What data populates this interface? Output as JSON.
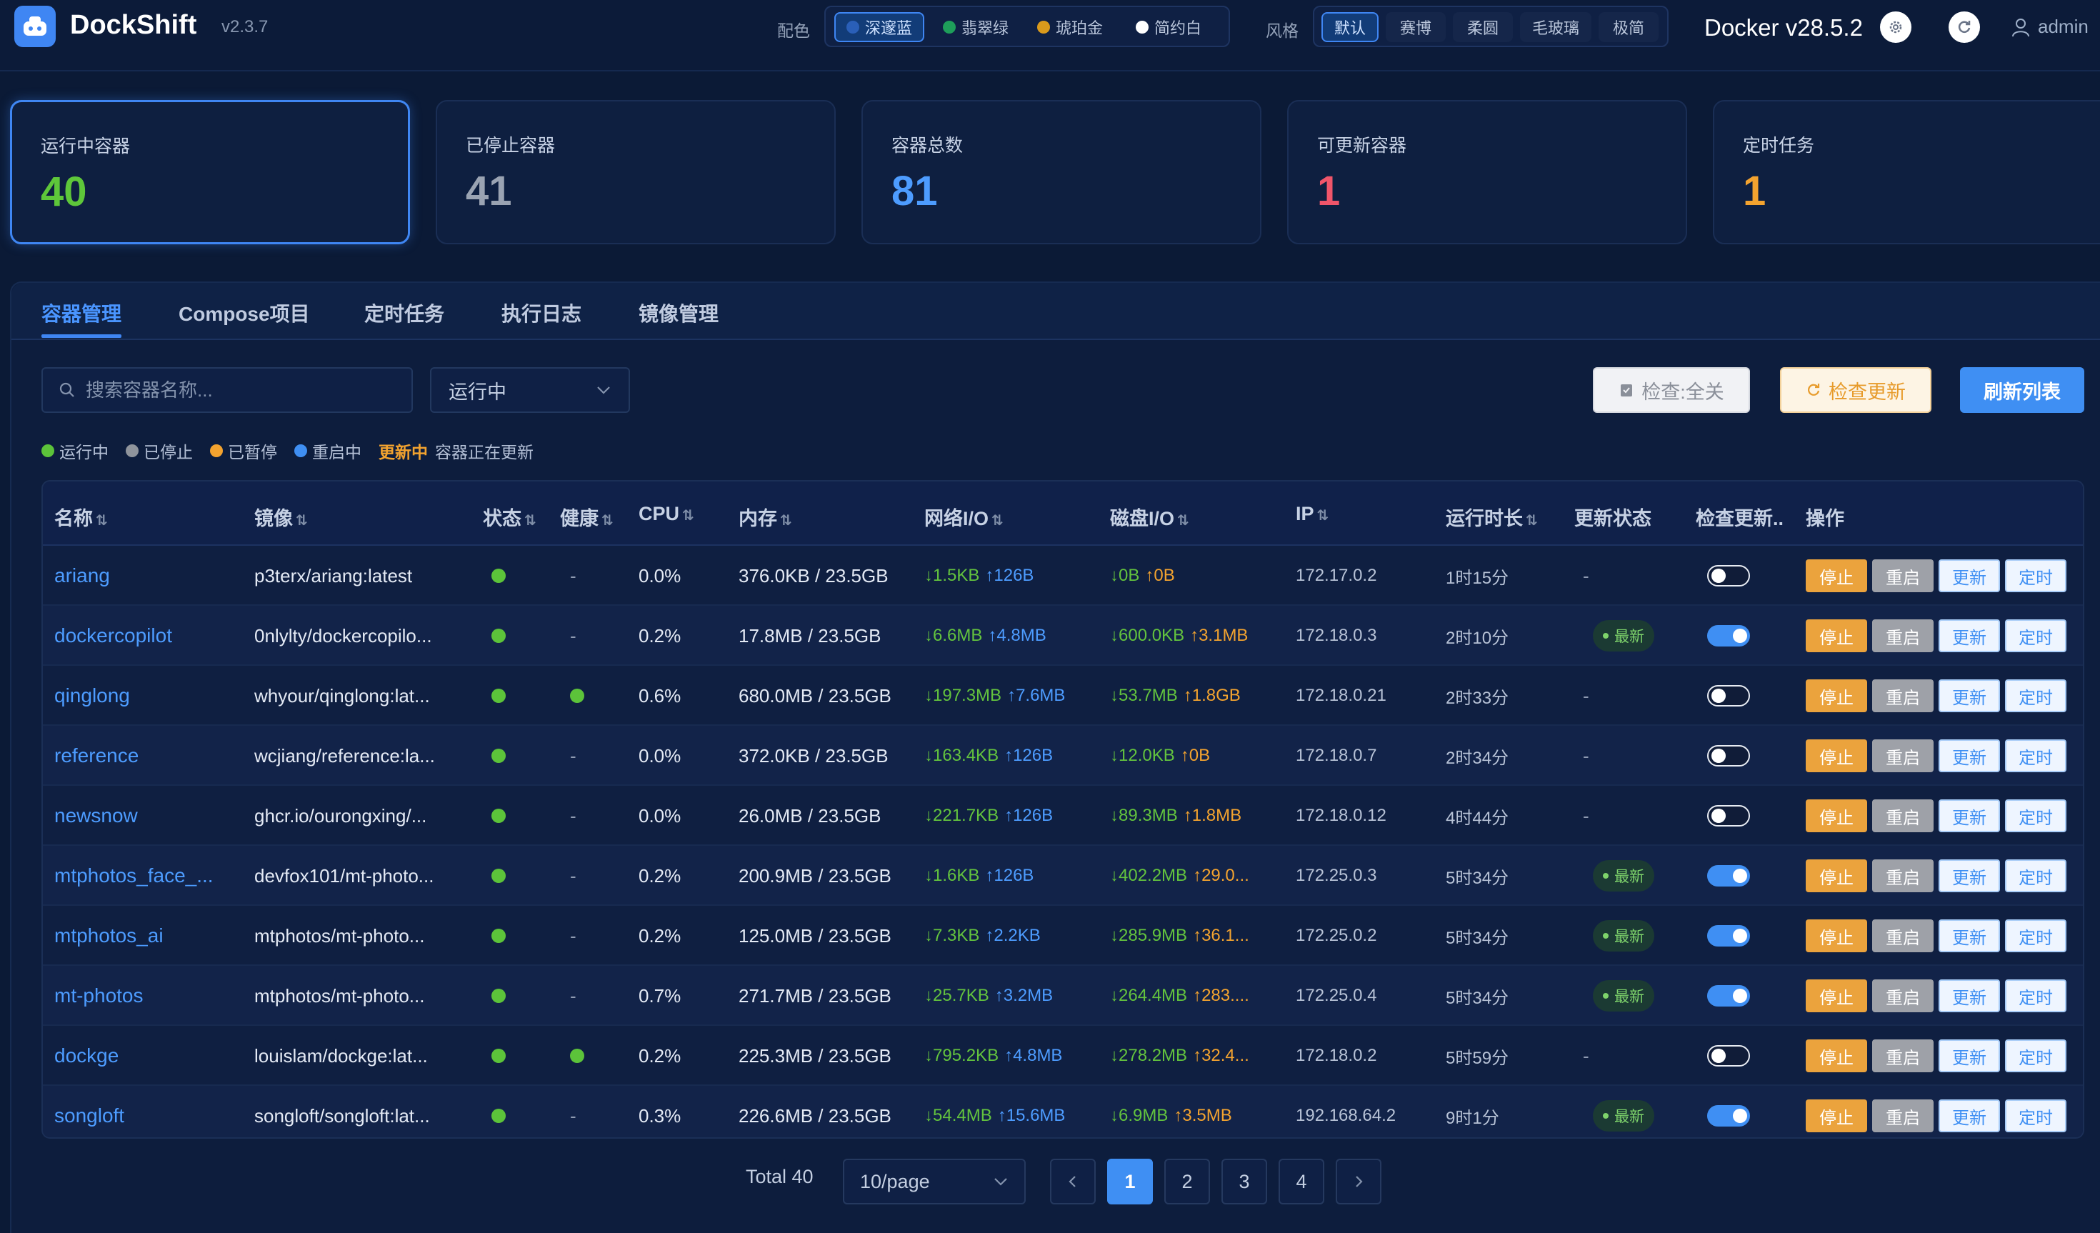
{
  "header": {
    "brand": "DockShift",
    "version": "v2.3.7",
    "color_label": "配色",
    "color_options": [
      {
        "label": "深邃蓝",
        "color": "#2a5fb8"
      },
      {
        "label": "翡翠绿",
        "color": "#1e9e5a"
      },
      {
        "label": "琥珀金",
        "color": "#d99a1c"
      },
      {
        "label": "简约白",
        "color": "#ffffff"
      }
    ],
    "style_label": "风格",
    "style_options": [
      "默认",
      "赛博",
      "柔圆",
      "毛玻璃",
      "极简"
    ],
    "docker_version": "Docker v28.5.2",
    "user": "admin"
  },
  "stats": [
    {
      "label": "运行中容器",
      "value": "40",
      "color": "#5ec73a"
    },
    {
      "label": "已停止容器",
      "value": "41",
      "color": "#9aa3b2"
    },
    {
      "label": "容器总数",
      "value": "81",
      "color": "#4d9cff"
    },
    {
      "label": "可更新容器",
      "value": "1",
      "color": "#f0556a"
    },
    {
      "label": "定时任务",
      "value": "1",
      "color": "#f3a32f"
    }
  ],
  "tabs": [
    "容器管理",
    "Compose项目",
    "定时任务",
    "执行日志",
    "镜像管理"
  ],
  "toolbar": {
    "search_placeholder": "搜索容器名称...",
    "status_filter": "运行中",
    "check_toggle_label": "检查:全关",
    "check_update_label": "检查更新",
    "refresh_label": "刷新列表"
  },
  "legend": {
    "running": "运行中",
    "stopped": "已停止",
    "paused": "已暂停",
    "restarting": "重启中",
    "updating_tag": "更新中",
    "updating_desc": "容器正在更新"
  },
  "table": {
    "headers": [
      "名称",
      "镜像",
      "状态",
      "健康",
      "CPU",
      "内存",
      "网络I/O",
      "磁盘I/O",
      "IP",
      "运行时长",
      "更新状态",
      "检查更新..",
      "操作"
    ],
    "action_labels": {
      "stop": "停止",
      "restart": "重启",
      "update": "更新",
      "timer": "定时"
    },
    "latest_label": "最新",
    "rows": [
      {
        "name": "ariang",
        "image": "p3terx/ariang:latest",
        "health": "-",
        "cpu": "0.0%",
        "mem": "376.0KB / 23.5GB",
        "net_down": "↓1.5KB",
        "net_up": "↑126B",
        "disk_down": "↓0B",
        "disk_up": "↑0B",
        "ip": "172.17.0.2",
        "uptime": "1时15分",
        "update_status": "-",
        "check": false
      },
      {
        "name": "dockercopilot",
        "image": "0nlylty/dockercopilo...",
        "health": "-",
        "cpu": "0.2%",
        "mem": "17.8MB / 23.5GB",
        "net_down": "↓6.6MB",
        "net_up": "↑4.8MB",
        "disk_down": "↓600.0KB",
        "disk_up": "↑3.1MB",
        "ip": "172.18.0.3",
        "uptime": "2时10分",
        "update_status": "latest",
        "check": true
      },
      {
        "name": "qinglong",
        "image": "whyour/qinglong:lat...",
        "health": "dot",
        "cpu": "0.6%",
        "mem": "680.0MB / 23.5GB",
        "net_down": "↓197.3MB",
        "net_up": "↑7.6MB",
        "disk_down": "↓53.7MB",
        "disk_up": "↑1.8GB",
        "ip": "172.18.0.21",
        "uptime": "2时33分",
        "update_status": "-",
        "check": false
      },
      {
        "name": "reference",
        "image": "wcjiang/reference:la...",
        "health": "-",
        "cpu": "0.0%",
        "mem": "372.0KB / 23.5GB",
        "net_down": "↓163.4KB",
        "net_up": "↑126B",
        "disk_down": "↓12.0KB",
        "disk_up": "↑0B",
        "ip": "172.18.0.7",
        "uptime": "2时34分",
        "update_status": "-",
        "check": false
      },
      {
        "name": "newsnow",
        "image": "ghcr.io/ourongxing/...",
        "health": "-",
        "cpu": "0.0%",
        "mem": "26.0MB / 23.5GB",
        "net_down": "↓221.7KB",
        "net_up": "↑126B",
        "disk_down": "↓89.3MB",
        "disk_up": "↑1.8MB",
        "ip": "172.18.0.12",
        "uptime": "4时44分",
        "update_status": "-",
        "check": false
      },
      {
        "name": "mtphotos_face_...",
        "image": "devfox101/mt-photo...",
        "health": "-",
        "cpu": "0.2%",
        "mem": "200.9MB / 23.5GB",
        "net_down": "↓1.6KB",
        "net_up": "↑126B",
        "disk_down": "↓402.2MB",
        "disk_up": "↑29.0...",
        "ip": "172.25.0.3",
        "uptime": "5时34分",
        "update_status": "latest",
        "check": true
      },
      {
        "name": "mtphotos_ai",
        "image": "mtphotos/mt-photo...",
        "health": "-",
        "cpu": "0.2%",
        "mem": "125.0MB / 23.5GB",
        "net_down": "↓7.3KB",
        "net_up": "↑2.2KB",
        "disk_down": "↓285.9MB",
        "disk_up": "↑36.1...",
        "ip": "172.25.0.2",
        "uptime": "5时34分",
        "update_status": "latest",
        "check": true
      },
      {
        "name": "mt-photos",
        "image": "mtphotos/mt-photo...",
        "health": "-",
        "cpu": "0.7%",
        "mem": "271.7MB / 23.5GB",
        "net_down": "↓25.7KB",
        "net_up": "↑3.2MB",
        "disk_down": "↓264.4MB",
        "disk_up": "↑283....",
        "ip": "172.25.0.4",
        "uptime": "5时34分",
        "update_status": "latest",
        "check": true
      },
      {
        "name": "dockge",
        "image": "louislam/dockge:lat...",
        "health": "dot",
        "cpu": "0.2%",
        "mem": "225.3MB / 23.5GB",
        "net_down": "↓795.2KB",
        "net_up": "↑4.8MB",
        "disk_down": "↓278.2MB",
        "disk_up": "↑32.4...",
        "ip": "172.18.0.2",
        "uptime": "5时59分",
        "update_status": "-",
        "check": false
      },
      {
        "name": "songloft",
        "image": "songloft/songloft:lat...",
        "health": "-",
        "cpu": "0.3%",
        "mem": "226.6MB / 23.5GB",
        "net_down": "↓54.4MB",
        "net_up": "↑15.6MB",
        "disk_down": "↓6.9MB",
        "disk_up": "↑3.5MB",
        "ip": "192.168.64.2",
        "uptime": "9时1分",
        "update_status": "latest",
        "check": true
      }
    ]
  },
  "pagination": {
    "total": "Total 40",
    "page_size": "10/page",
    "pages": [
      "1",
      "2",
      "3",
      "4"
    ],
    "current": "1"
  }
}
